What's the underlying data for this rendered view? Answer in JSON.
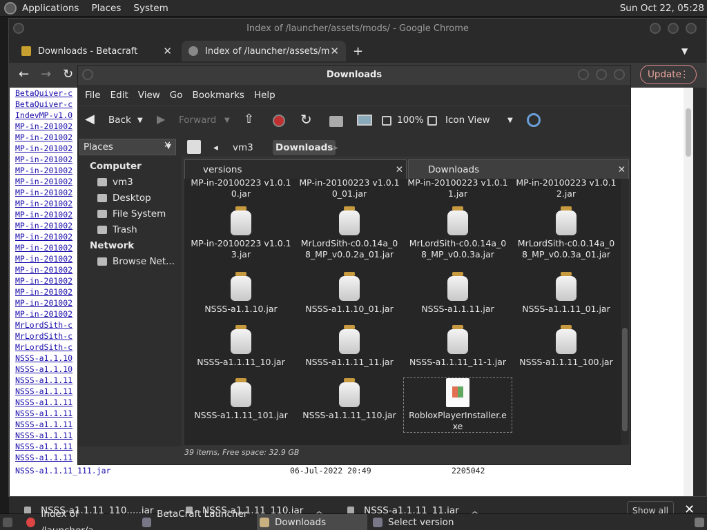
{
  "top_panel": {
    "menus": [
      "Applications",
      "Places",
      "System"
    ],
    "clock": "Sun Oct 22, 05:28"
  },
  "chrome": {
    "window_title": "Index of /launcher/assets/mods/ - Google Chrome",
    "tabs": [
      {
        "title": "Downloads - Betacraft",
        "icon": "betacraft-icon"
      },
      {
        "title": "Index of /launcher/assets/mod",
        "icon": "globe-icon"
      }
    ],
    "new_tab": "+",
    "update_label": "Update"
  },
  "page": {
    "links": [
      "BetaQuiver-c",
      "BetaQuiver-c",
      "IndevMP-v1.0",
      "MP-in-201002",
      "MP-in-201002",
      "MP-in-201002",
      "MP-in-201002",
      "MP-in-201002",
      "MP-in-201002",
      "MP-in-201002",
      "MP-in-201002",
      "MP-in-201002",
      "MP-in-201002",
      "MP-in-201002",
      "MP-in-201002",
      "MP-in-201002",
      "MP-in-201002",
      "MP-in-201002",
      "MP-in-201002",
      "MP-in-201002",
      "MP-in-201002",
      "MrLordSith-c",
      "MrLordSith-c",
      "MrLordSith-c",
      "NSSS-a1.1.10",
      "NSSS-a1.1.10",
      "NSSS-a1.1.11",
      "NSSS-a1.1.11",
      "NSSS-a1.1.11",
      "NSSS-a1.1.11",
      "NSSS-a1.1.11",
      "NSSS-a1.1.11",
      "NSSS-a1.1.11",
      "NSSS-a1.1.11"
    ],
    "last_row": {
      "name": "NSSS-a1.1.11_111.jar",
      "date": "06-Jul-2022 20:49",
      "size": "2205042"
    }
  },
  "downloads_shelf": {
    "items": [
      "NSSS-a1.1.11_110.....jar",
      "NSSS-a1.1.11_110.jar",
      "NSSS-a1.1.11_11.jar"
    ],
    "show_all": "Show all"
  },
  "nautilus": {
    "title": "Downloads",
    "menu": [
      "File",
      "Edit",
      "View",
      "Go",
      "Bookmarks",
      "Help"
    ],
    "toolbar": {
      "back": "Back",
      "forward": "Forward",
      "zoom": "100%",
      "view_mode": "Icon View"
    },
    "places_label": "Places",
    "breadcrumb": [
      "vm3",
      "Downloads"
    ],
    "sidebar": {
      "computer_header": "Computer",
      "computer_items": [
        {
          "label": "vm3",
          "icon": "home-folder-icon"
        },
        {
          "label": "Desktop",
          "icon": "desktop-icon"
        },
        {
          "label": "File System",
          "icon": "drive-icon"
        },
        {
          "label": "Trash",
          "icon": "trash-icon"
        }
      ],
      "network_header": "Network",
      "network_items": [
        {
          "label": "Browse Net...",
          "icon": "network-icon"
        }
      ]
    },
    "tabs": [
      "versions",
      "Downloads"
    ],
    "files": [
      "MP-in-20100223 v1.0.10.jar",
      "MP-in-20100223 v1.0.10_01.jar",
      "MP-in-20100223 v1.0.11.jar",
      "MP-in-20100223 v1.0.12.jar",
      "MP-in-20100223 v1.0.13.jar",
      "MrLordSith-c0.0.14a_08_MP_v0.0.2a_01.jar",
      "MrLordSith-c0.0.14a_08_MP_v0.0.3a.jar",
      "MrLordSith-c0.0.14a_08_MP_v0.0.3a_01.jar",
      "NSSS-a1.1.10.jar",
      "NSSS-a1.1.10_01.jar",
      "NSSS-a1.1.11.jar",
      "NSSS-a1.1.11_01.jar",
      "NSSS-a1.1.11_10.jar",
      "NSSS-a1.1.11_11.jar",
      "NSSS-a1.1.11_11-1.jar",
      "NSSS-a1.1.11_100.jar",
      "NSSS-a1.1.11_101.jar",
      "NSSS-a1.1.11_110.jar",
      "RobloxPlayerInstaller.exe"
    ],
    "status": "39 items, Free space: 32.9 GB"
  },
  "taskbar": {
    "items": [
      {
        "label": "Index of /launcher/a...",
        "icon": "chrome-icon"
      },
      {
        "label": "BetaCraft Launcher ...",
        "icon": "java-icon"
      },
      {
        "label": "Downloads",
        "icon": "folder-icon"
      },
      {
        "label": "Select version",
        "icon": "java-icon"
      }
    ]
  }
}
